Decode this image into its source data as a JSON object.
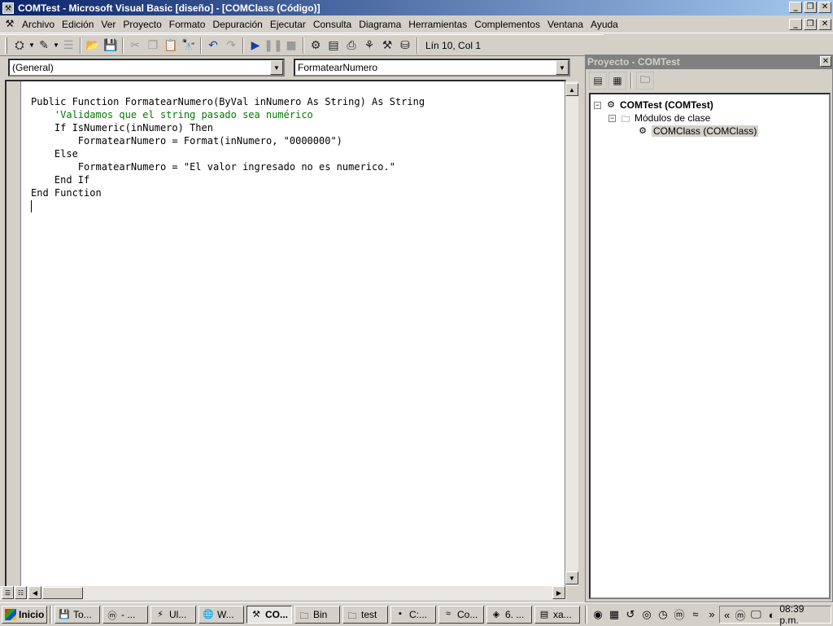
{
  "window": {
    "title": "COMTest - Microsoft Visual Basic [diseño] - [COMClass (Código)]",
    "controls": [
      "_",
      "❐",
      "✕"
    ]
  },
  "menu": {
    "items": [
      "Archivo",
      "Edición",
      "Ver",
      "Proyecto",
      "Formato",
      "Depuración",
      "Ejecutar",
      "Consulta",
      "Diagrama",
      "Herramientas",
      "Complementos",
      "Ventana",
      "Ayuda"
    ]
  },
  "toolbar": {
    "position": "Lín 10, Col 1"
  },
  "code_window": {
    "object_combo": "(General)",
    "procedure_combo": "FormatearNumero",
    "lines": [
      "Public Function FormatearNumero(ByVal inNumero As String) As String",
      "    'Validamos que el string pasado sea numérico",
      "    If IsNumeric(inNumero) Then",
      "        FormatearNumero = Format(inNumero, \"0000000\")",
      "    Else",
      "        FormatearNumero = \"El valor ingresado no es numerico.\"",
      "    End If",
      "End Function"
    ]
  },
  "project": {
    "title": "Proyecto - COMTest",
    "tree": {
      "root": "COMTest (COMTest)",
      "folder": "Módulos de clase",
      "item": "COMClass (COMClass)"
    }
  },
  "taskbar": {
    "start": "Inicio",
    "tasks": [
      "To...",
      "- ...",
      "Ul...",
      "W...",
      "CO...",
      "Bin",
      "test",
      "C:...",
      "Co...",
      "6. ...",
      "xa..."
    ],
    "clock": "08:39 p.m.",
    "tray_chevron": "«"
  }
}
